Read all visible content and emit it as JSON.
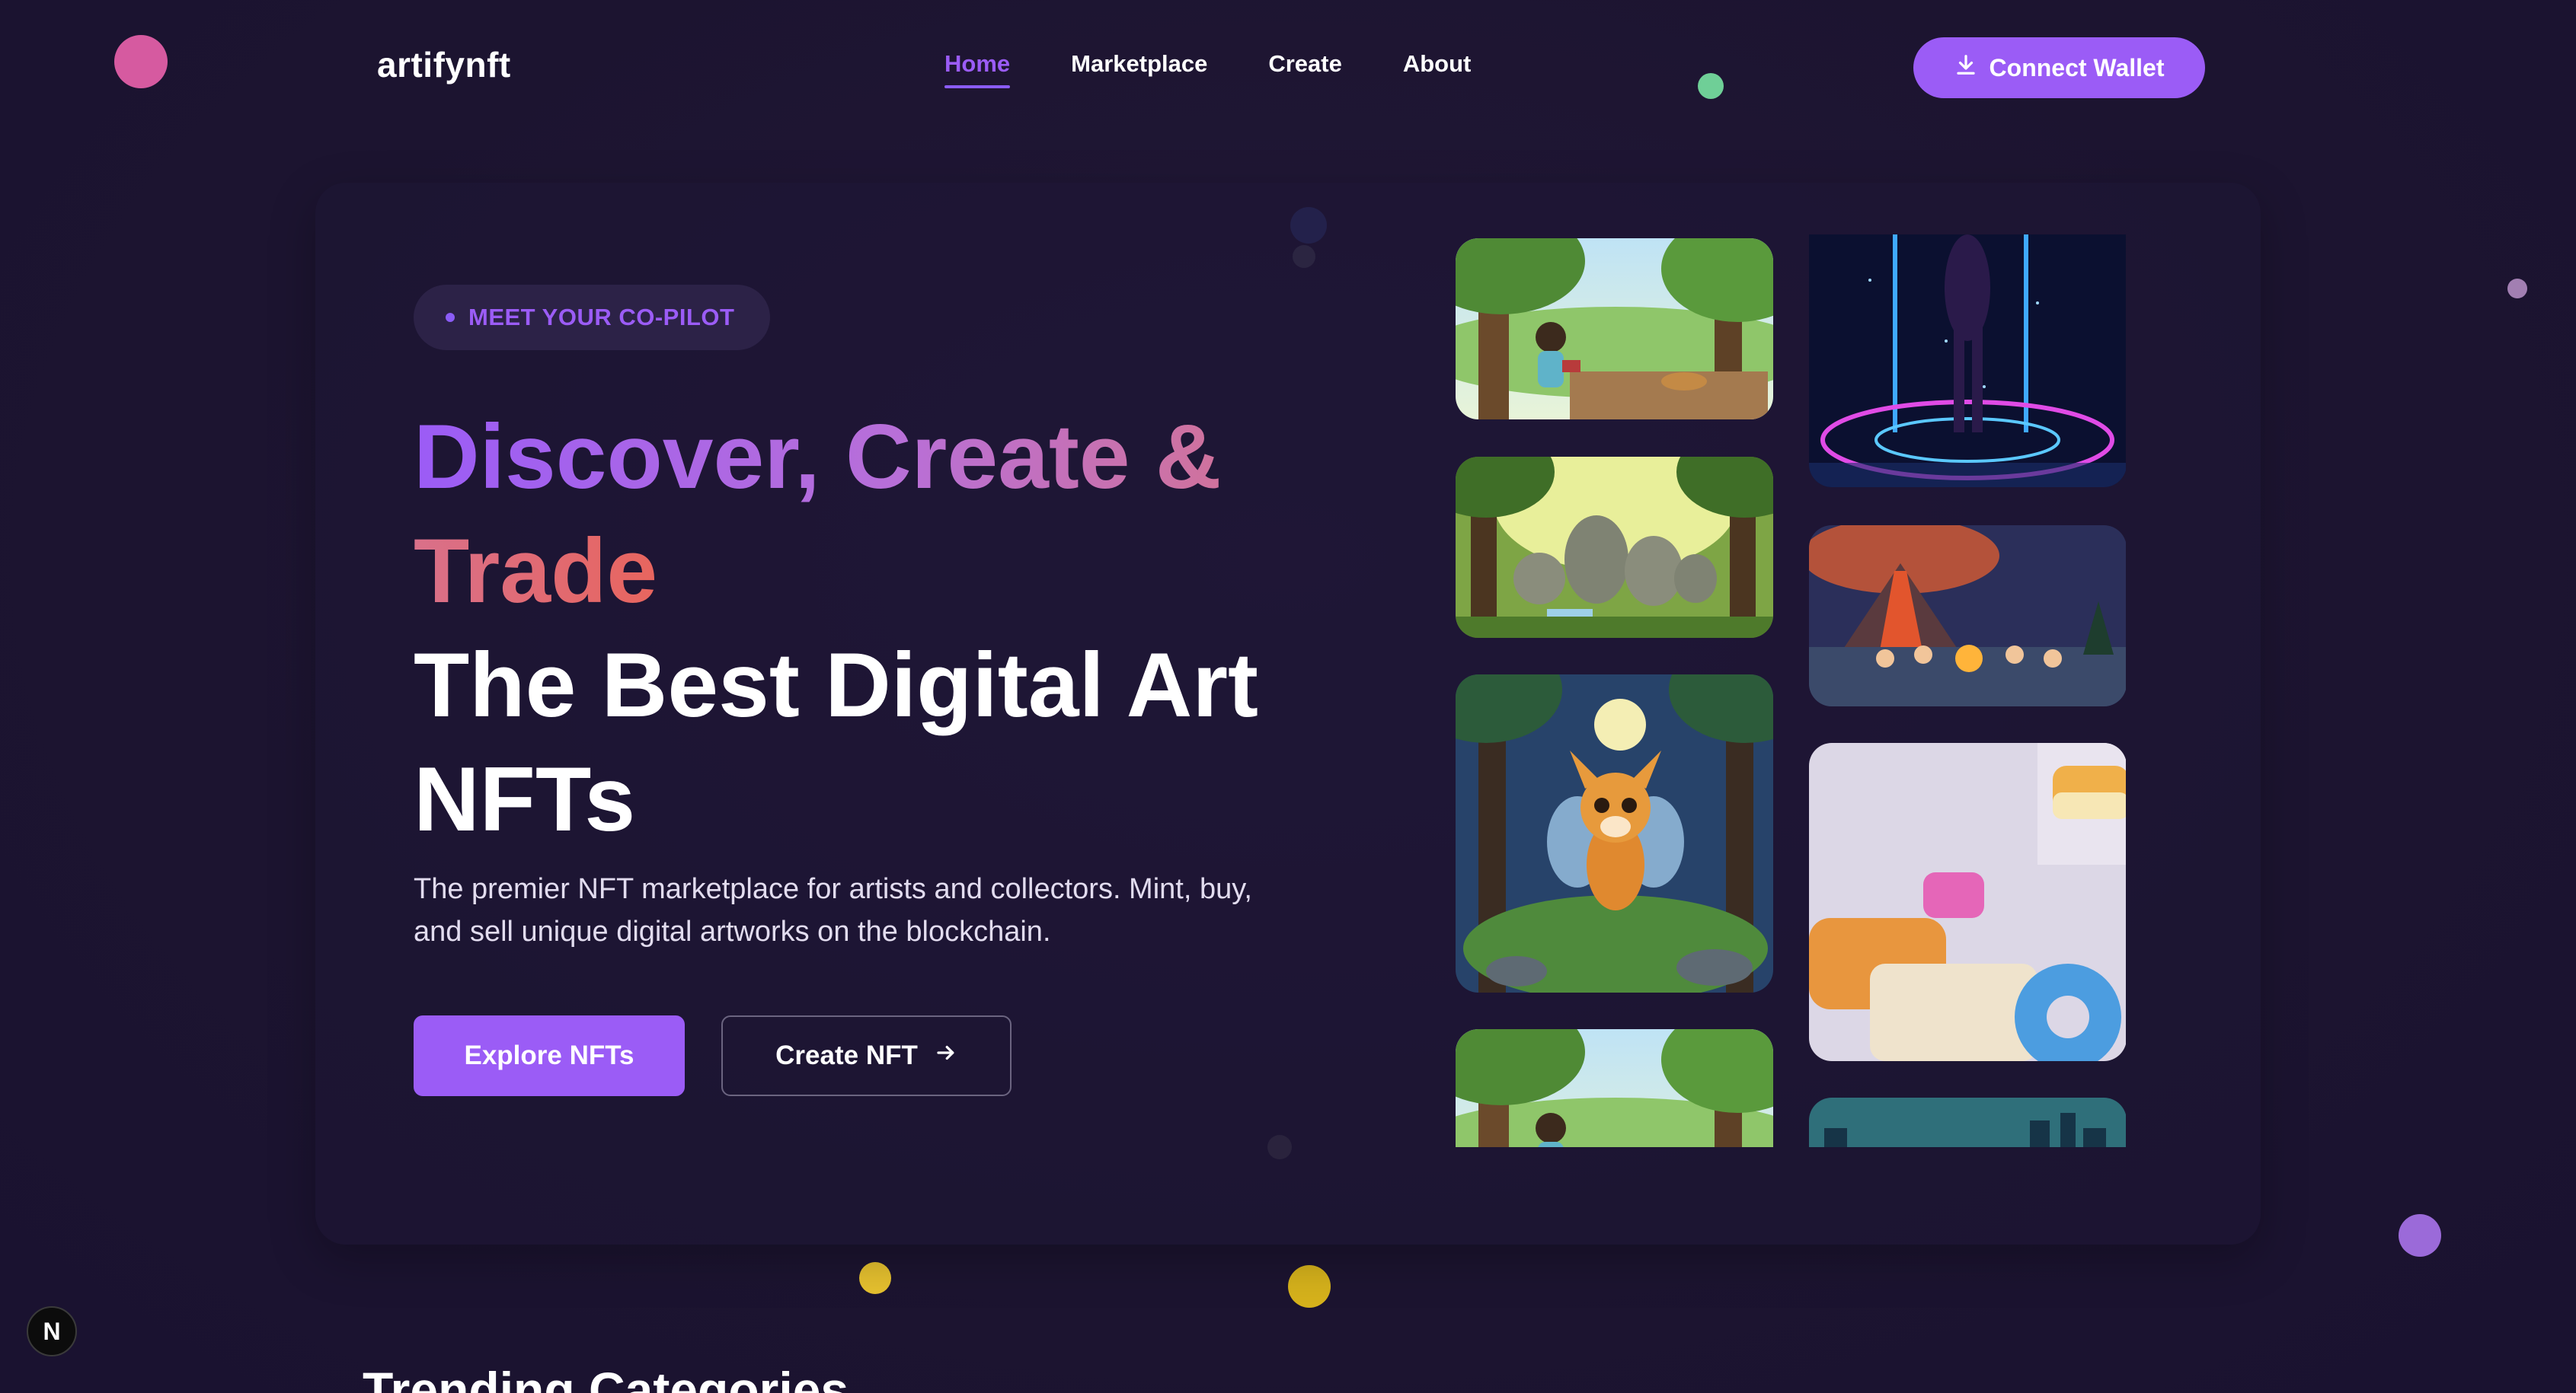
{
  "nav": {
    "brand": "artifynft",
    "links": [
      {
        "label": "Home",
        "active": true
      },
      {
        "label": "Marketplace",
        "active": false
      },
      {
        "label": "Create",
        "active": false
      },
      {
        "label": "About",
        "active": false
      }
    ],
    "wallet_button": "Connect Wallet",
    "wallet_icon": "download-icon"
  },
  "hero": {
    "badge": "MEET YOUR CO-PILOT",
    "headline_line1": "Discover, Create &",
    "headline_line2": "Trade",
    "headline_line3": "The Best Digital Art",
    "headline_line4": "NFTs",
    "subtext": "The premier NFT marketplace for artists and collectors. Mint, buy, and sell unique digital artworks on the blockchain.",
    "primary_button": "Explore NFTs",
    "secondary_button": "Create NFT",
    "secondary_icon": "arrow-right-icon"
  },
  "gallery": {
    "artworks": [
      "girl-reading-in-forest",
      "stone-creatures-in-forest",
      "fawn-fairy-under-moon",
      "girl-reading-in-forest",
      "neon-dancer-silhouette",
      "campfire-by-volcano",
      "pastel-candy-blocks",
      "city-skyline-at-dusk"
    ]
  },
  "dev_badge": "N",
  "next_section": {
    "title": "Trending Categories"
  },
  "colors": {
    "background": "#1c1430",
    "accent": "#9b5cf6",
    "gradient_pink": "#d0729c",
    "gradient_coral": "#e8655e"
  }
}
